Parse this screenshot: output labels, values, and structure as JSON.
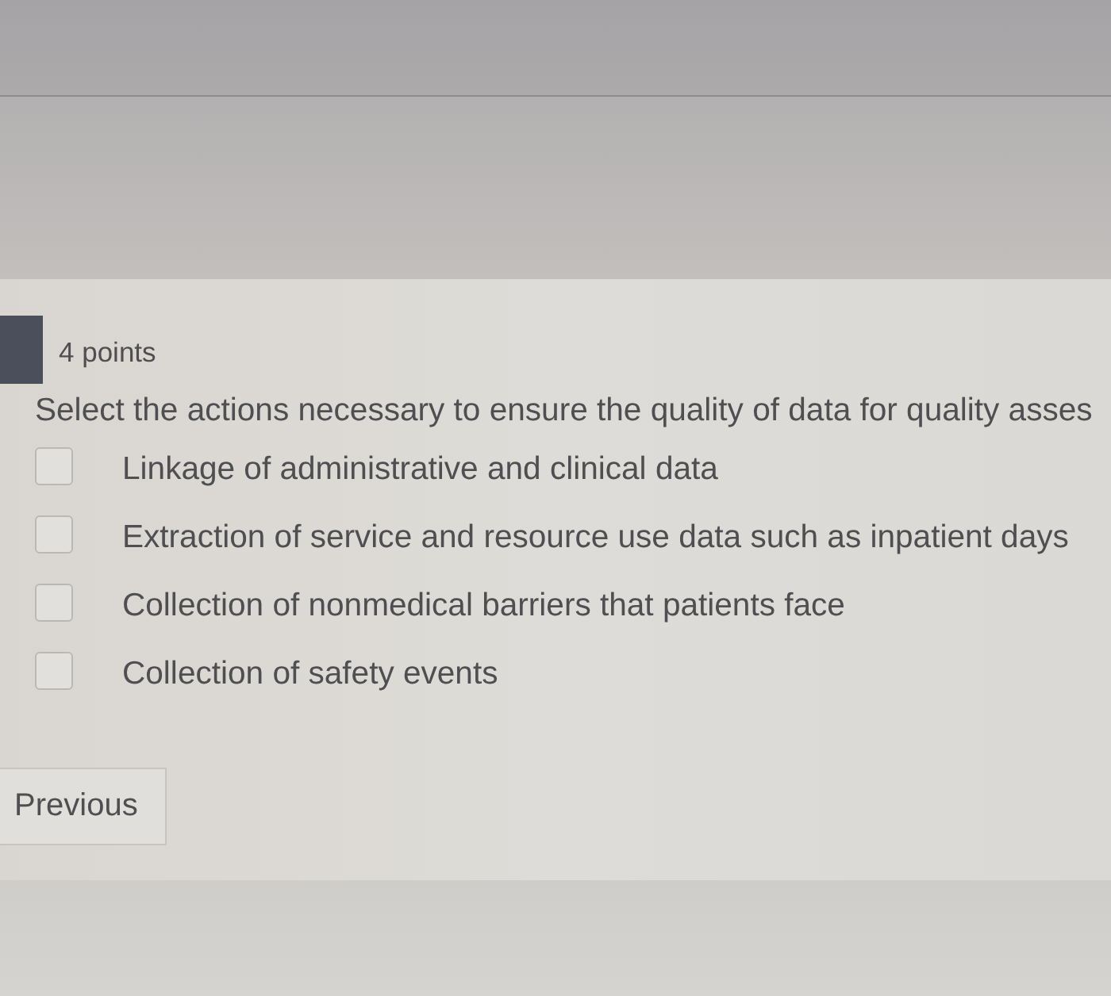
{
  "question": {
    "points": "4 points",
    "prompt": "Select the actions necessary to ensure the quality of data for quality asses",
    "options": [
      {
        "label": "Linkage of administrative and clinical data",
        "checked": false
      },
      {
        "label": "Extraction of service and resource use data such as inpatient days",
        "checked": false
      },
      {
        "label": "Collection of nonmedical barriers that patients face",
        "checked": false
      },
      {
        "label": "Collection of safety events",
        "checked": false
      }
    ]
  },
  "navigation": {
    "previous": "Previous"
  }
}
